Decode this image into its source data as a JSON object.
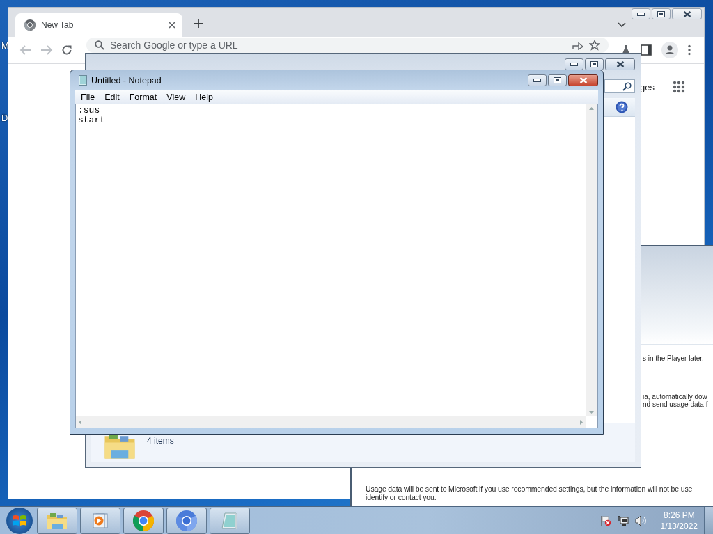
{
  "desktop": {
    "icon_labels": [
      "M",
      "D"
    ]
  },
  "chrome": {
    "tab": {
      "title": "New Tab",
      "selected": true
    },
    "omnibox": {
      "placeholder": "Search Google or type a URL"
    },
    "page": {
      "link_fragment": "ges"
    }
  },
  "media_player": {
    "lines": [
      "s in the Player later.",
      "ia, automatically dow",
      "nd send usage data f"
    ],
    "footer": [
      "Usage data will be sent to Microsoft if you use recommended settings, but the information will not be use",
      "identify or contact you."
    ]
  },
  "explorer": {
    "status": "4 items"
  },
  "notepad": {
    "title": "Untitled - Notepad",
    "menu": [
      "File",
      "Edit",
      "Format",
      "View",
      "Help"
    ],
    "lines": [
      ":sus",
      "start "
    ]
  },
  "taskbar": {
    "buttons": [
      {
        "kind": "explorer"
      },
      {
        "kind": "media"
      },
      {
        "kind": "chrome"
      },
      {
        "kind": "chromium"
      },
      {
        "kind": "notepad"
      }
    ],
    "clock": {
      "time": "8:26 PM",
      "date": "1/13/2022"
    }
  }
}
